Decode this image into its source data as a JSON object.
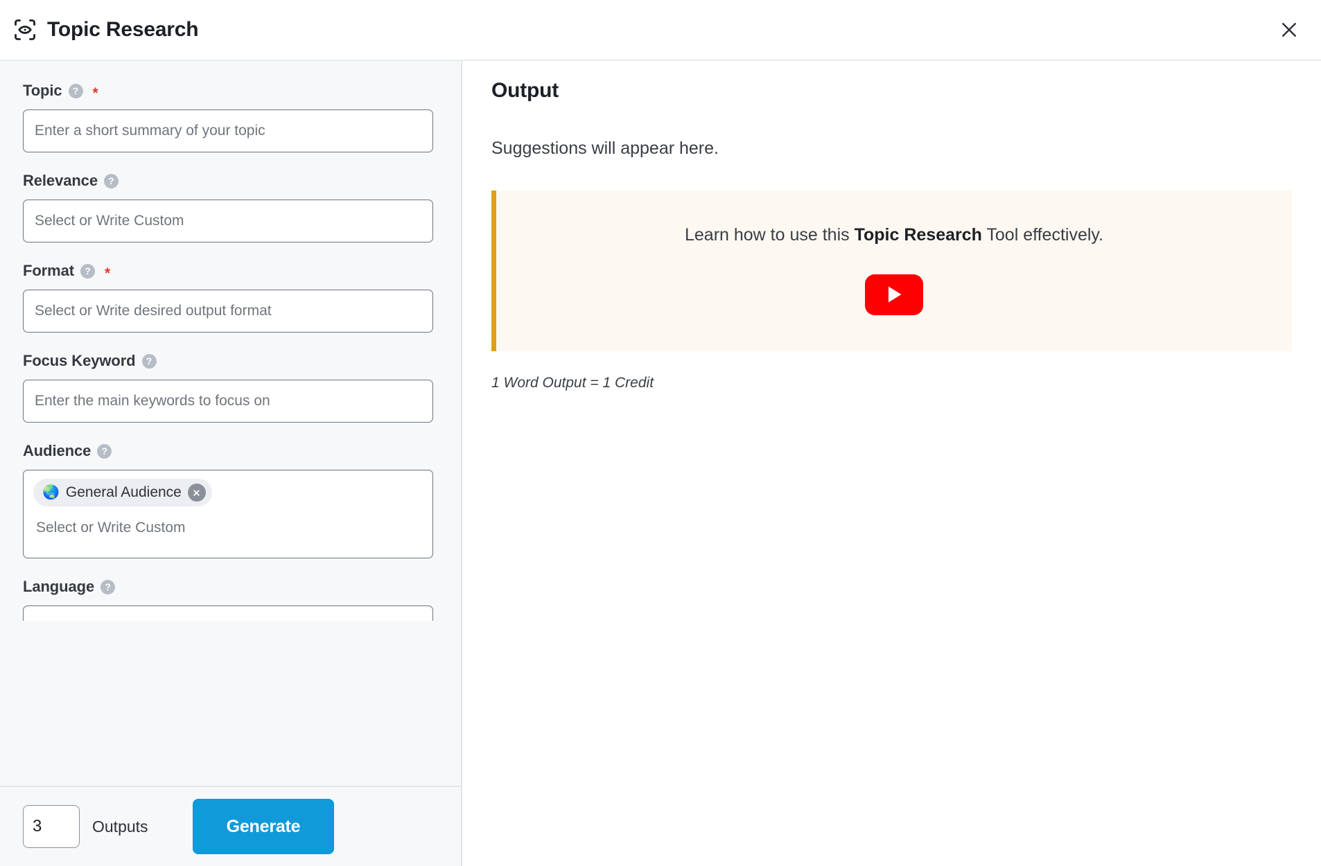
{
  "header": {
    "icon": "scan-eye-icon",
    "title": "Topic Research",
    "close_label": "close-icon"
  },
  "form": {
    "fields": [
      {
        "label": "Topic",
        "help": "?",
        "required": true,
        "required_marker": "*",
        "placeholder": "Enter a short summary of your topic",
        "value": "",
        "type": "text"
      },
      {
        "label": "Relevance",
        "help": "?",
        "required": false,
        "required_marker": "",
        "placeholder": "Select or Write Custom",
        "value": "",
        "type": "text"
      },
      {
        "label": "Format",
        "help": "?",
        "required": true,
        "required_marker": "*",
        "placeholder": "Select or Write desired output format",
        "value": "",
        "type": "text"
      },
      {
        "label": "Focus Keyword",
        "help": "?",
        "required": false,
        "required_marker": "",
        "placeholder": "Enter the main keywords to focus on",
        "value": "",
        "type": "text"
      },
      {
        "label": "Audience",
        "help": "?",
        "required": false,
        "required_marker": "",
        "placeholder": "Select or Write Custom",
        "value": "",
        "type": "tags",
        "tags": [
          {
            "emoji": "🌏",
            "text": "General Audience",
            "remove": "×"
          }
        ]
      },
      {
        "label": "Language",
        "help": "?",
        "required": false,
        "required_marker": "",
        "placeholder": "",
        "value": "",
        "type": "cut-off"
      }
    ]
  },
  "footer": {
    "outputs_count": "3",
    "outputs_label": "Outputs",
    "generate_label": "Generate"
  },
  "output": {
    "title": "Output",
    "subtitle": "Suggestions will appear here.",
    "callout": {
      "text_before": "Learn how to use this ",
      "text_bold": "Topic Research",
      "text_after": " Tool effectively.",
      "play_button": "youtube-play-icon"
    },
    "credit_note": "1 Word Output = 1 Credit"
  },
  "colors": {
    "accent_blue": "#109AD9",
    "callout_border": "#DFA017",
    "callout_bg": "#FDF8F1",
    "required_red": "#E8342A",
    "youtube_red": "#FF0000",
    "panel_bg": "#F7F8FA",
    "chip_bg": "#ECEEF1"
  }
}
